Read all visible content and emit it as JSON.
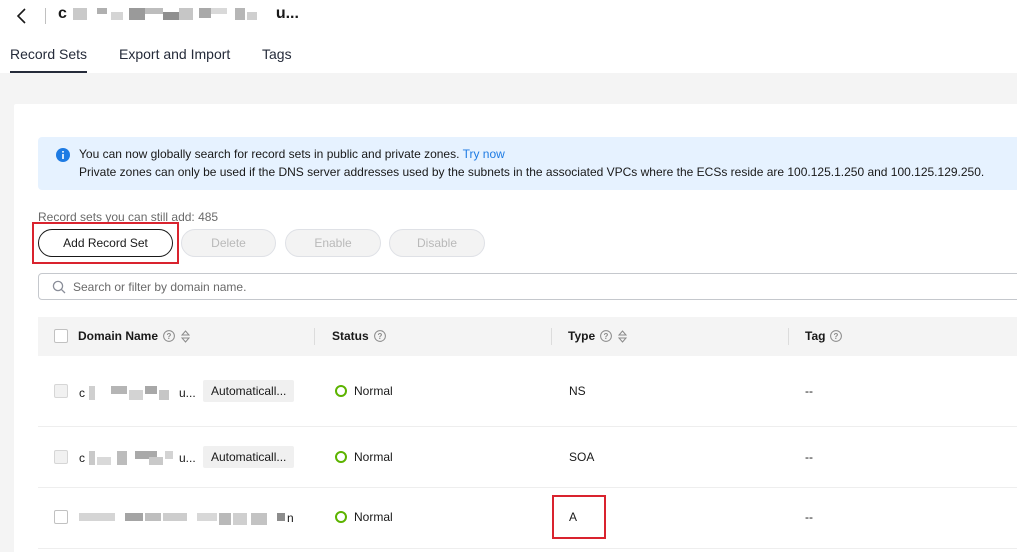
{
  "header": {
    "zone_name_start": "c",
    "zone_name_end": "u..."
  },
  "tabs": [
    {
      "label": "Record Sets",
      "active": true
    },
    {
      "label": "Export and Import",
      "active": false
    },
    {
      "label": "Tags",
      "active": false
    }
  ],
  "notice": {
    "line1": "You can now globally search for record sets in public and private zones.",
    "link": "Try now",
    "line2": "Private zones can only be used if the DNS server addresses used by the subnets in the associated VPCs where the ECSs reside are 100.125.1.250 and 100.125.129.250."
  },
  "quota_text": "Record sets you can still add: 485",
  "toolbar": {
    "add_label": "Add Record Set",
    "delete_label": "Delete",
    "enable_label": "Enable",
    "disable_label": "Disable"
  },
  "search": {
    "placeholder": "Search or filter by domain name."
  },
  "table": {
    "columns": {
      "domain": "Domain Name",
      "status": "Status",
      "type": "Type",
      "tag": "Tag"
    },
    "rows": [
      {
        "domain_start": "c",
        "domain_end": "u...",
        "badge": "Automaticall...",
        "status": "Normal",
        "type": "NS",
        "tag": "--"
      },
      {
        "domain_start": "c",
        "domain_end": "u...",
        "badge": "Automaticall...",
        "status": "Normal",
        "type": "SOA",
        "tag": "--"
      },
      {
        "domain_start": "",
        "domain_end": "n",
        "badge": "",
        "status": "Normal",
        "type": "A",
        "tag": "--"
      }
    ]
  },
  "colors": {
    "accent_link": "#1e7be3",
    "notice_bg": "#e6f2ff",
    "status_normal": "#5cb300",
    "highlight_box": "#d9232e"
  },
  "icons": {
    "back": "chevron-left-icon",
    "info": "info-icon",
    "search": "search-icon",
    "help": "question-circle-icon",
    "sort": "sort-icon"
  }
}
